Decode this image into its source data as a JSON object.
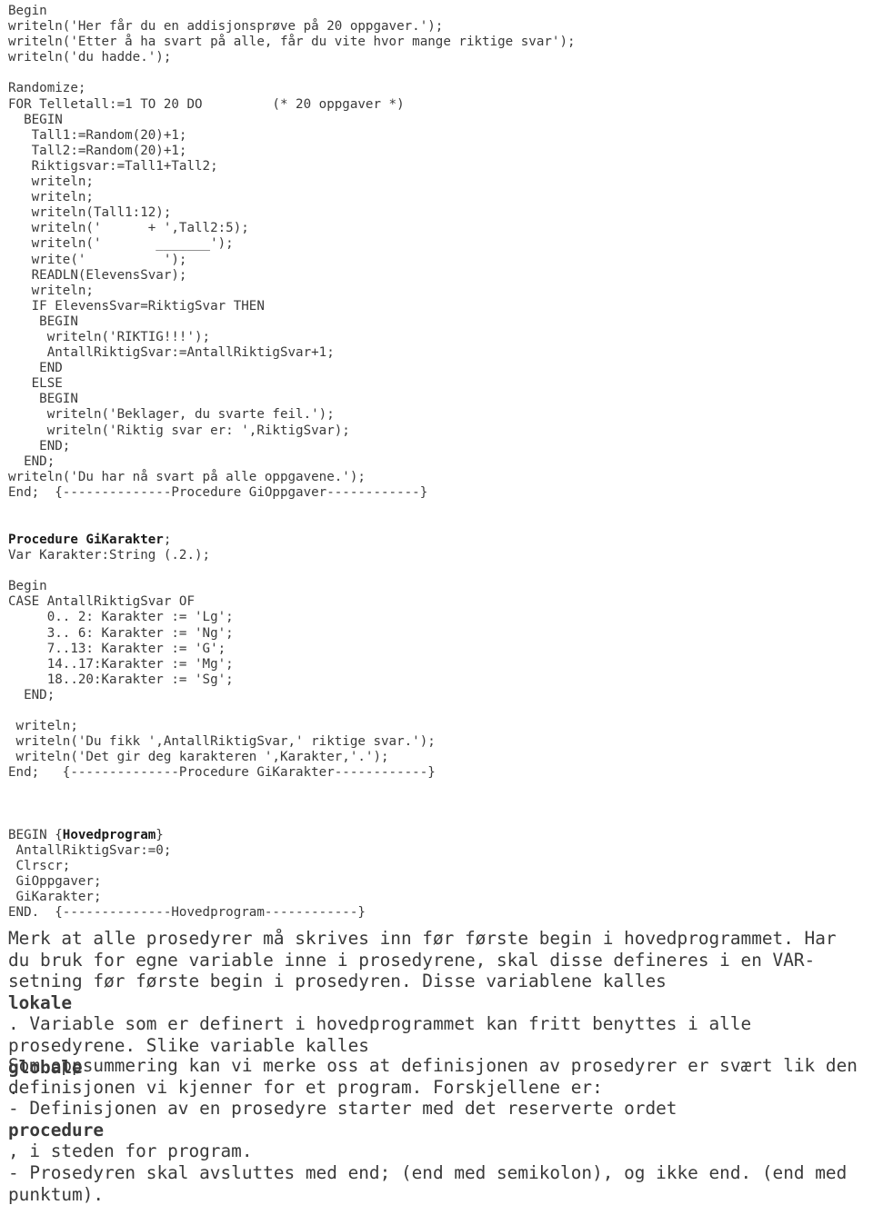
{
  "document": {
    "language": "no",
    "text_color": "#3a3a3a",
    "background_color": "#ffffff"
  },
  "code": {
    "procedure_gioppgaver_body": [
      "Begin",
      "writeln('Her får du en addisjonsprøve på 20 oppgaver.');",
      "writeln('Etter å ha svart på alle, får du vite hvor mange riktige svar');",
      "writeln('du hadde.');",
      "",
      "Randomize;",
      "FOR Telletall:=1 TO 20 DO         (* 20 oppgaver *)",
      "  BEGIN",
      "   Tall1:=Random(20)+1;",
      "   Tall2:=Random(20)+1;",
      "   Riktigsvar:=Tall1+Tall2;",
      "   writeln;",
      "   writeln;",
      "   writeln(Tall1:12);",
      "   writeln('      + ',Tall2:5);",
      "   writeln('       _______');",
      "   write('          ');",
      "   READLN(ElevensSvar);",
      "   writeln;",
      "   IF ElevensSvar=RiktigSvar THEN",
      "    BEGIN",
      "     writeln('RIKTIG!!!');",
      "     AntallRiktigSvar:=AntallRiktigSvar+1;",
      "    END",
      "   ELSE",
      "    BEGIN",
      "     writeln('Beklager, du svarte feil.');",
      "     writeln('Riktig svar er: ',RiktigSvar);",
      "    END;",
      "  END;",
      "writeln('Du har nå svart på alle oppgavene.');",
      "End;  {--------------Procedure GiOppgaver------------}"
    ],
    "procedure_gikarakter_heading_bold": "Procedure GiKarakter",
    "procedure_gikarakter_heading_tail": ";",
    "procedure_gikarakter_body": [
      "Var Karakter:String (.2.);",
      "",
      "Begin",
      "CASE AntallRiktigSvar OF",
      "     0.. 2: Karakter := 'Lg';",
      "     3.. 6: Karakter := 'Ng';",
      "     7..13: Karakter := 'G';",
      "     14..17:Karakter := 'Mg';",
      "     18..20:Karakter := 'Sg';",
      "  END;",
      "",
      " writeln;",
      " writeln('Du fikk ',AntallRiktigSvar,' riktige svar.');",
      " writeln('Det gir deg karakteren ',Karakter,'.');",
      "End;   {--------------Procedure GiKarakter------------}"
    ],
    "main_program_open_prefix": "BEGIN {",
    "main_program_open_bold": "Hovedprogram",
    "main_program_open_suffix": "}",
    "main_program_body": [
      " AntallRiktigSvar:=0;",
      " Clrscr;",
      " GiOppgaver;",
      " GiKarakter;",
      "END.  {--------------Hovedprogram------------}"
    ]
  },
  "prose": {
    "paragraph1": {
      "seg1": "Merk at alle prosedyrer må skrives inn før første begin i hovedprogrammet. Har du bruk for egne variable inne i prosedyrene, skal disse defineres i en VAR-setning før første begin i prosedyren. Disse variablene kalles ",
      "bold1": "lokale",
      "seg2": ". Variable som er definert i hovedprogrammet kan fritt benyttes i alle prosedyrene. Slike variable kalles ",
      "bold2": "globale",
      "seg3": "."
    },
    "paragraph2": {
      "seg1": "Som oppsummering kan vi merke oss at definisjonen av prosedyrer er svært lik den definisjonen vi kjenner for et program. Forskjellene er:\n- Definisjonen av en prosedyre starter med det reserverte ordet ",
      "bold1": "procedure",
      "seg2": ", i steden for program.\n- Prosedyren skal avsluttes med end; (end med semikolon), og ikke end. (end med punktum)."
    }
  }
}
